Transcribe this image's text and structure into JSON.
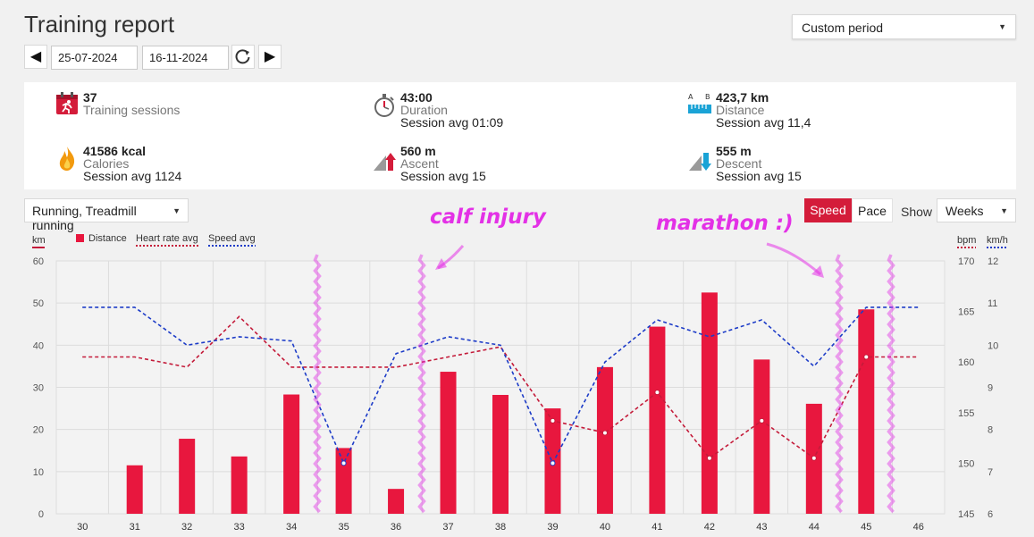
{
  "header": {
    "title": "Training report",
    "period": "Custom period"
  },
  "dates": {
    "from": "25-07-2024",
    "to": "16-11-2024"
  },
  "icons": {
    "prev": "◀",
    "next": "▶",
    "refresh": "refresh-icon",
    "caret": "▼"
  },
  "summary": {
    "sessions": {
      "value": "37",
      "label": "Training sessions"
    },
    "duration": {
      "value": "43:00",
      "label": "Duration",
      "avg": "Session avg 01:09"
    },
    "distance": {
      "value": "423,7 km",
      "label": "Distance",
      "avg": "Session avg 11,4"
    },
    "calories": {
      "value": "41586 kcal",
      "label": "Calories",
      "avg": "Session avg 1124"
    },
    "ascent": {
      "value": "560 m",
      "label": "Ascent",
      "avg": "Session avg 15"
    },
    "descent": {
      "value": "555 m",
      "label": "Descent",
      "avg": "Session avg 15"
    }
  },
  "controls": {
    "sport": "Running, Treadmill running",
    "speed": "Speed",
    "pace": "Pace",
    "show": "Show",
    "group": "Weeks"
  },
  "colors": {
    "accent": "#d41c3a",
    "bar": "#e8173e",
    "hr": "#c41b3a",
    "speed": "#1d3cc8",
    "annotation": "#e331e6"
  },
  "annotations": {
    "injury": "calf injury",
    "marathon": "marathon :)"
  },
  "chart_data": {
    "type": "bar",
    "x": [
      "30",
      "31",
      "32",
      "33",
      "34",
      "35",
      "36",
      "37",
      "38",
      "39",
      "40",
      "41",
      "42",
      "43",
      "44",
      "45",
      "46"
    ],
    "legend": [
      "Distance",
      "Heart rate avg",
      "Speed avg"
    ],
    "axes": {
      "left": {
        "unit": "km",
        "ticks": [
          "0",
          "10",
          "20",
          "30",
          "40",
          "50",
          "60"
        ],
        "range": [
          0,
          60
        ]
      },
      "right1": {
        "unit": "bpm",
        "ticks": [
          "145",
          "150",
          "155",
          "160",
          "165",
          "170"
        ],
        "range": [
          145,
          170
        ]
      },
      "right2": {
        "unit": "km/h",
        "ticks": [
          "6",
          "7",
          "8",
          "9",
          "10",
          "11",
          "12"
        ],
        "range": [
          6,
          12
        ]
      }
    },
    "series": [
      {
        "name": "Distance",
        "type": "bar",
        "axis": "left",
        "values": [
          null,
          11.5,
          17.8,
          13.6,
          28.3,
          15.6,
          5.9,
          33.7,
          28.2,
          25.0,
          34.8,
          44.4,
          52.5,
          36.6,
          26.1,
          48.5,
          null
        ]
      },
      {
        "name": "Heart rate avg",
        "type": "line",
        "axis": "right1",
        "values": [
          160.5,
          160.5,
          159.5,
          164.5,
          159.5,
          159.5,
          159.5,
          160.5,
          161.5,
          154.2,
          153.0,
          157.0,
          150.5,
          154.2,
          150.5,
          160.5,
          160.5
        ]
      },
      {
        "name": "Speed avg",
        "type": "line",
        "axis": "right2",
        "values": [
          10.9,
          10.9,
          10.0,
          10.2,
          10.1,
          7.2,
          9.8,
          10.2,
          10.0,
          7.2,
          9.6,
          10.6,
          10.2,
          10.6,
          9.5,
          10.9,
          10.9
        ]
      }
    ]
  }
}
